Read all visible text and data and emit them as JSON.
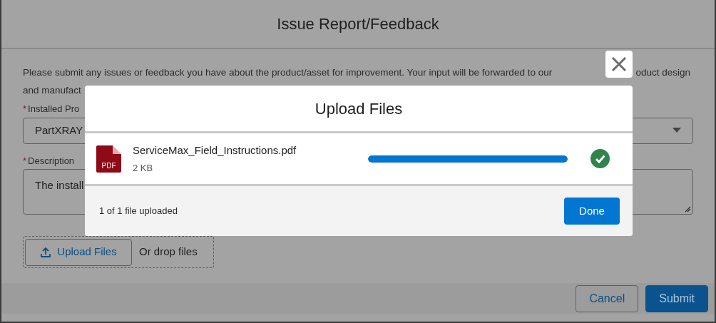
{
  "dialog": {
    "title": "Issue Report/Feedback",
    "intro_lines": [
      "Please submit any issues or feedback you have about the product/asset for improvement. Your input will be forwarded to our",
      "oduct design",
      "and manufact"
    ],
    "fields": [
      {
        "label": "Installed Pro",
        "required": true,
        "required_mark": "*",
        "kind": "select",
        "value": "PartXRAY"
      },
      {
        "label": "Description",
        "required": true,
        "required_mark": "*",
        "kind": "textarea",
        "value": "The install"
      }
    ],
    "upload": {
      "button": "Upload Files",
      "drop_text": "Or drop files"
    },
    "buttons": [
      {
        "label": "Cancel",
        "kind": "neutral"
      },
      {
        "label": "Submit",
        "kind": "brand"
      }
    ]
  },
  "upload_modal": {
    "title": "Upload Files",
    "files": [
      {
        "name": "ServiceMax_Field_Instructions.pdf",
        "size": "2 KB",
        "type": "PDF",
        "level": 1,
        "complete": true
      }
    ],
    "status": "1 of 1 file uploaded",
    "button": "Done"
  }
}
